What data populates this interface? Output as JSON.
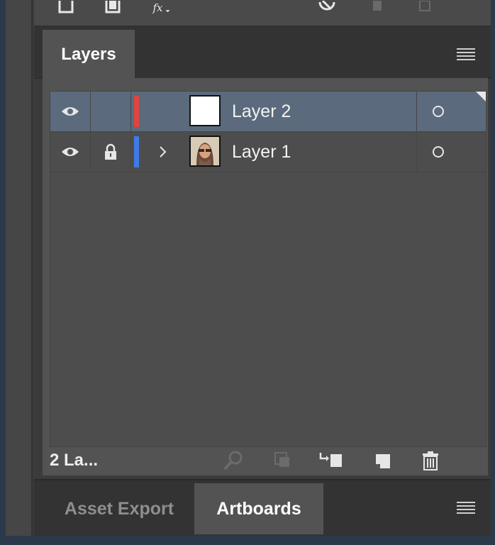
{
  "layers_panel": {
    "tab_label": "Layers",
    "layers": [
      {
        "name": "Layer 2",
        "color": "#e0443e",
        "locked": false,
        "selected": true,
        "has_children": false,
        "thumbnail": "blank"
      },
      {
        "name": "Layer 1",
        "color": "#3f7ae8",
        "locked": true,
        "selected": false,
        "has_children": true,
        "thumbnail": "photo"
      }
    ],
    "layer_count_label": "2 La..."
  },
  "bottom_tabs": {
    "asset_export_label": "Asset Export",
    "artboards_label": "Artboards"
  },
  "icons": {
    "visibility": "eye-icon",
    "lock": "lock-icon",
    "expand": "chevron-right-icon",
    "target": "target-circle-icon",
    "menu": "hamburger-menu-icon",
    "footer": [
      "search-icon",
      "clipping-mask-icon",
      "new-sublayer-icon",
      "new-layer-icon",
      "trash-icon"
    ]
  },
  "colors": {
    "selection": "#5b6b7d",
    "panel": "#535353",
    "tab_bar": "#333333"
  }
}
